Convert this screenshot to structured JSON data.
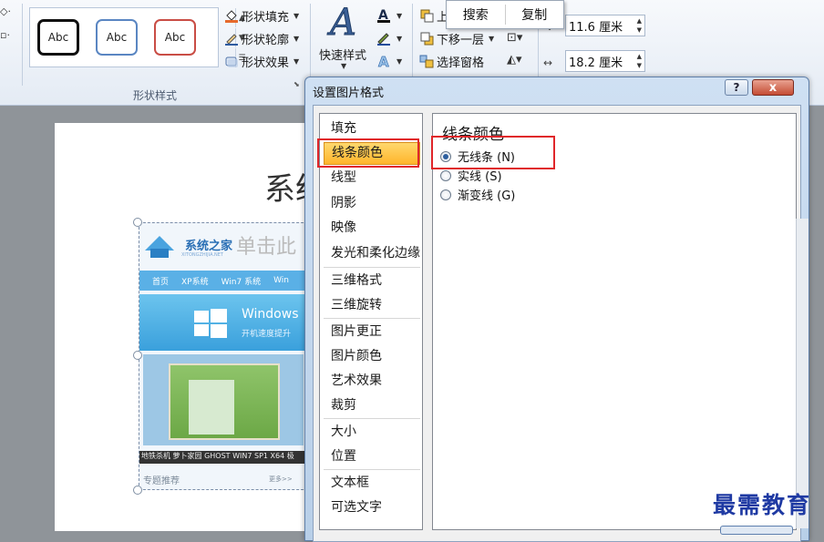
{
  "ribbon": {
    "shape_styles": [
      "Abc",
      "Abc",
      "Abc"
    ],
    "shape_fill": "形状填充",
    "shape_outline": "形状轮廓",
    "shape_effects": "形状效果",
    "group_label": "形状样式",
    "quick_styles": "快速样式",
    "move_down": "下移一层",
    "selection_pane": "选择窗格",
    "height_value": "11.6 厘米",
    "width_value": "18.2 厘米"
  },
  "context_menu": {
    "search": "搜索",
    "copy": "复制"
  },
  "slide": {
    "title_fragment": "系统",
    "pic_logo": "系统之家",
    "pic_logo_sub": "XITONGZHIJIA.NET",
    "pic_overlay": "单击此",
    "pic_nav": [
      "首页",
      "XP系统",
      "Win7 系统",
      "Win"
    ],
    "pic_banner": "Windows",
    "pic_banner_sub": "开机速度提升",
    "pic_caption": "地铁杀机 萝卜家园 GHOST WIN7 SP1 X64 极",
    "pic_footer": "专题推荐",
    "pic_more": "更多>>"
  },
  "dialog": {
    "title": "设置图片格式",
    "help": "?",
    "close": "x",
    "nav_groups": [
      [
        "填充",
        "线条颜色",
        "线型",
        "阴影",
        "映像",
        "发光和柔化边缘"
      ],
      [
        "三维格式",
        "三维旋转"
      ],
      [
        "图片更正",
        "图片颜色",
        "艺术效果",
        "裁剪"
      ],
      [
        "大小",
        "位置"
      ],
      [
        "文本框",
        "可选文字"
      ]
    ],
    "selected_nav": "线条颜色",
    "panel_title": "线条颜色",
    "options": [
      {
        "label": "无线条 (N)",
        "checked": true
      },
      {
        "label": "实线 (S)",
        "checked": false
      },
      {
        "label": "渐变线 (G)",
        "checked": false
      }
    ]
  },
  "watermark": "最需教育",
  "colors": {
    "highlight_box": "#e0262a",
    "nav_selected": "#ffc446",
    "watermark": "#1f3aa3"
  }
}
